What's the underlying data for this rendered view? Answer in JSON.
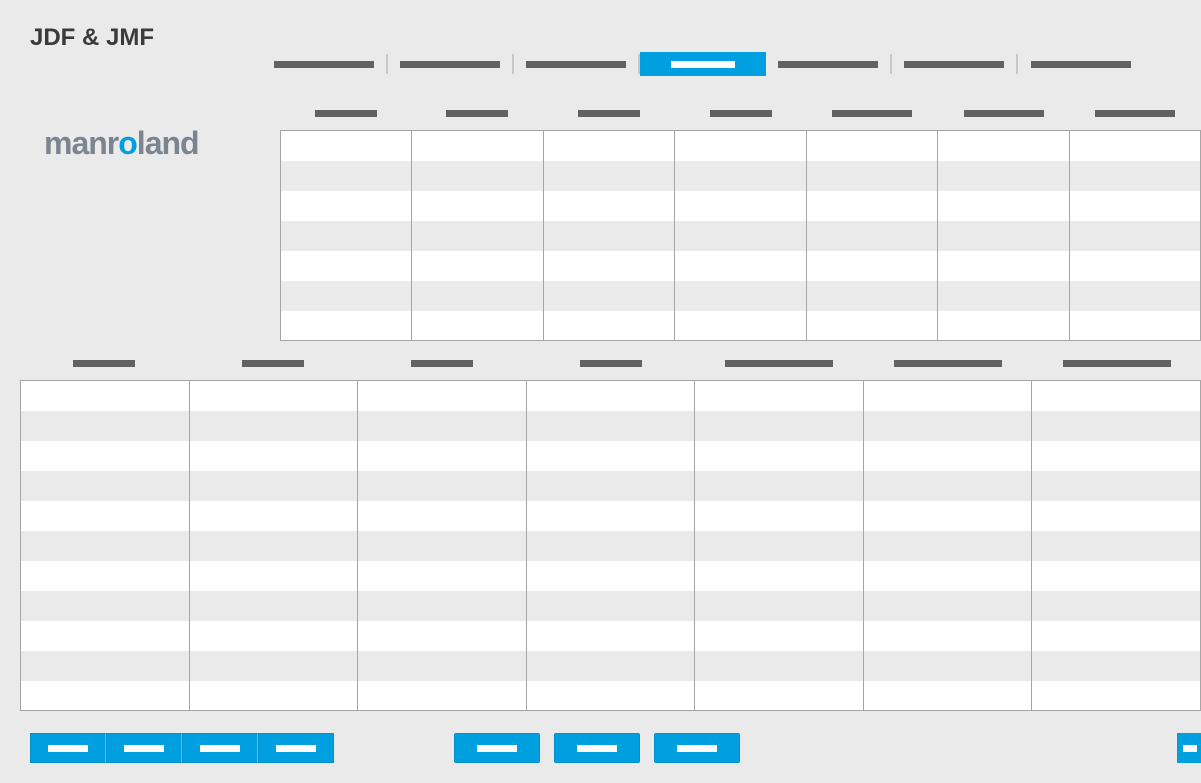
{
  "title": "JDF & JMF",
  "logo": {
    "prefix": "manr",
    "o": "o",
    "suffix": "land"
  },
  "topTabs": {
    "count": 7,
    "activeIndex": 3
  },
  "table1": {
    "columns": 7,
    "rows": 7,
    "headerWidths": [
      "",
      "",
      "",
      "",
      "med",
      "med",
      "med"
    ]
  },
  "table2": {
    "columns": 7,
    "rows": 11,
    "headerWidths": [
      "",
      "",
      "",
      "",
      "wide",
      "wide",
      "wide"
    ]
  },
  "bottomButtons": {
    "leftGroupCount": 4,
    "midGroupCount": 3
  }
}
